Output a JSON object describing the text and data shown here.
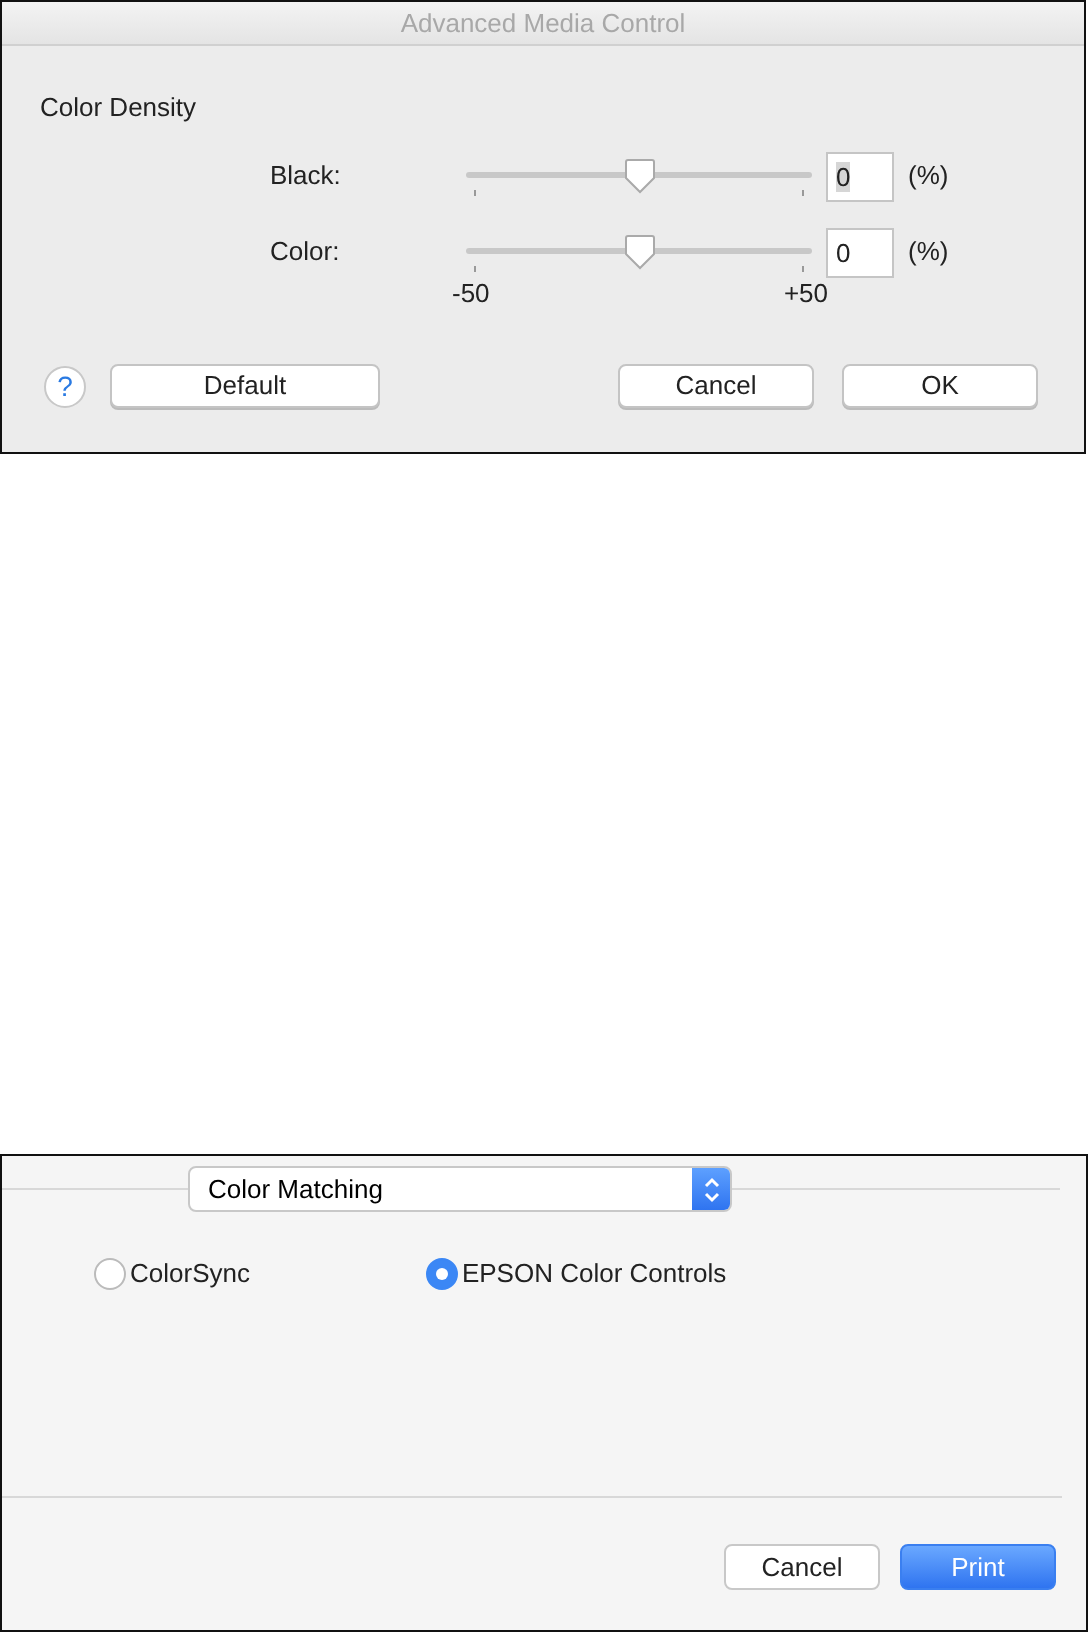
{
  "dialog": {
    "title": "Advanced Media Control",
    "section": "Color Density",
    "sliders": [
      {
        "label": "Black:",
        "level": 0.5,
        "value": "0",
        "text_selected": true,
        "unit": "(%)"
      },
      {
        "label": "Color:",
        "level": 0.5,
        "value": "0",
        "text_selected": false,
        "unit": "(%)"
      }
    ],
    "scale": {
      "min": "-50",
      "max": "+50"
    },
    "help": "?",
    "buttons": [
      {
        "label": "Default"
      },
      {
        "label": "Cancel"
      },
      {
        "label": "OK"
      }
    ]
  },
  "print_panel": {
    "popup": "Color Matching",
    "radios": [
      {
        "label": "ColorSync",
        "selected": false
      },
      {
        "label": "EPSON Color Controls",
        "selected": true
      }
    ],
    "buttons": [
      {
        "label": "Cancel",
        "default": false
      },
      {
        "label": "Print",
        "default": true
      }
    ]
  }
}
